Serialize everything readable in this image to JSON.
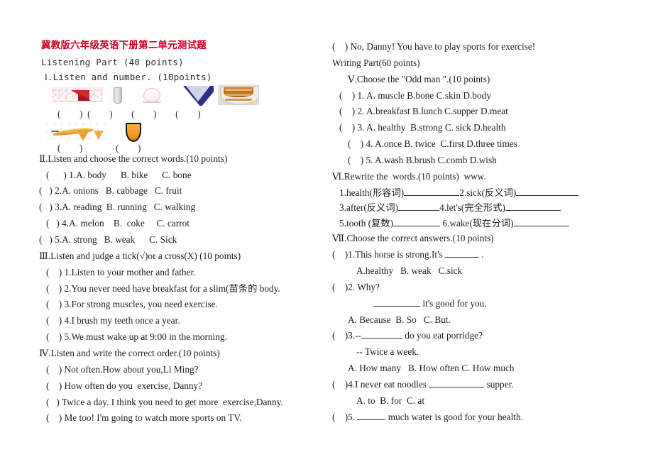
{
  "document": {
    "title": "冀教版六年级英语下册第二单元测试题",
    "title_color": "#cc0022"
  },
  "left_column": {
    "listening_part_heading": "Listening Part      (40 points)",
    "section_1": {
      "heading": "Ⅰ.Listen and number. (10points)",
      "images": [
        {
          "name": "meat-photo"
        },
        {
          "name": "glass-of-water-photo"
        },
        {
          "name": "tofu-photo"
        },
        {
          "name": "fish-photo"
        },
        {
          "name": "noodles-bowl-photo"
        },
        {
          "name": "banana-photo"
        },
        {
          "name": "carrot-photo"
        }
      ],
      "answer_row_1": "(        )  (        )        (        )        (        )",
      "answer_row_2": "(        )              (        )"
    },
    "section_2": {
      "heading": "Ⅱ.Listen and choose the correct words.(10 points)",
      "items": [
        "(      ) 1.A. body      B. bike      C. bone",
        "(   ) 2.A. onions   B. cabbage   C. fruit",
        "(   ) 3.A. reading  B. running   C. walking",
        "(   ) 4.A. melon    B.  coke     C. carrot",
        "(   ) 5.A. strong   B. weak      C. Sick"
      ]
    },
    "section_3": {
      "heading": "Ⅲ.Listen and judge a tick(√)or a cross(X) (10 points)",
      "items": [
        "(    ) 1.Listen to your mother and father.",
        "(    ) 2.You never need have breakfast for a slim(苗条的 body.",
        "(    ) 3.For strong muscles, you need exercise.",
        "(    ) 4.I brush my teeth once a year.",
        "(    ) 5.We must wake up at 9:00 in the morning."
      ]
    },
    "section_4": {
      "heading": "Ⅳ.Listen and write the correct order.(10 points)",
      "items": [
        "(    ) Not often.How about you,Li Ming?",
        "(    ) How often do you  exercise, Danny?",
        "(   ) Twice a day. I think you need to get more  exercise,Danny.",
        "(    ) Me too! I'm going to watch more sports on TV."
      ]
    }
  },
  "right_column": {
    "carryover_item": "(    ) No, Danny! You have to play sports for exercise!",
    "writing_part_heading": "Writing Part(60 points)",
    "section_5": {
      "heading": "Ⅴ.Choose the \"Odd man \".(10 points)",
      "items": [
        "(    ) 1. A. muscle B.bone C.skin D.body",
        "(    ) 2. A.breakfast B.lunch C.supper D.meat",
        "(    ) 3. A. healthy  B.strong C. sick D.health",
        "(    ) 4. A.once B. twice  C.first D.three times",
        "(    ) 5. A.wash B.brush C.comb D.wish"
      ]
    },
    "section_6": {
      "heading": "Ⅵ.Rewrite the  words.(10 points)  www.",
      "row1_a": "1.health(形容词)",
      "row1_b": "2.sick(反义词)",
      "row2_a": "3.after(反义词)",
      "row2_b": "4.let's(完全形式)",
      "row3_a": "5.tooth (复数)",
      "row3_b": "6.wake(现在分词)"
    },
    "section_7": {
      "heading": "Ⅶ.Choose the correct answers.(10 points)",
      "q1_stem_a": "(    )1.This horse is strong.It's ",
      "q1_stem_b": " .",
      "q1_options": "A.healthy   B. weak   C.sick",
      "q2_stem": "(    )2. Why?",
      "q2_blank_tail": " it's good for you.",
      "q2_options": "A. Because  B. So   C. But.",
      "q3_stem_a": "(    )3.--",
      "q3_stem_b": " do you eat porridge?",
      "q3_reply": "-- Twice a week.",
      "q3_options": "A. How many   B. How often C. How much",
      "q4_stem_a": "(    )4.I never eat noodles ",
      "q4_stem_b": " supper.",
      "q4_options": "A. to  B. for  C. at",
      "q5_stem_a": "(    )5. ",
      "q5_stem_b": " much water is good for your health."
    }
  }
}
